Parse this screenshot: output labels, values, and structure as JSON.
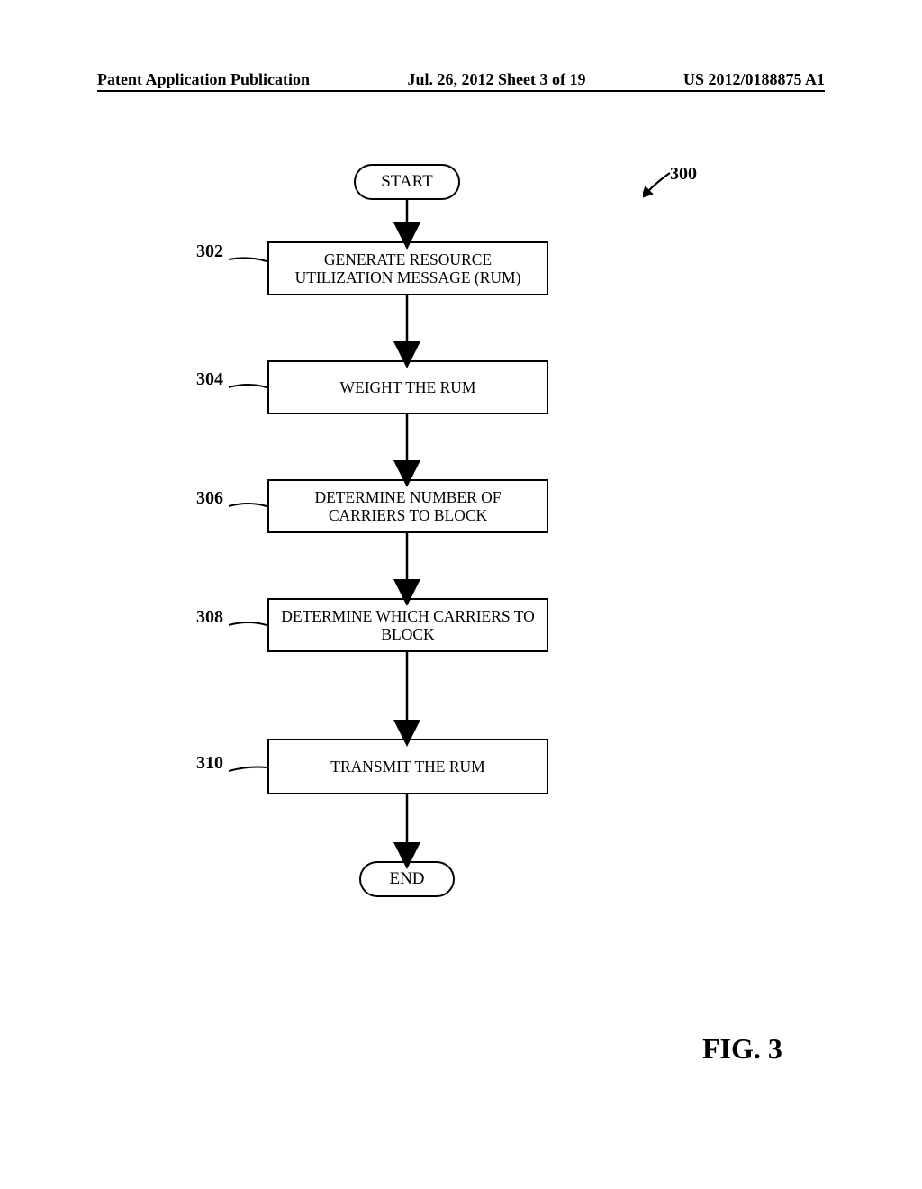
{
  "header": {
    "left": "Patent Application Publication",
    "center": "Jul. 26, 2012  Sheet 3 of 19",
    "right": "US 2012/0188875 A1"
  },
  "figure": {
    "reference": "300",
    "start": "START",
    "end": "END",
    "caption": "FIG. 3",
    "steps": [
      {
        "ref": "302",
        "text": "GENERATE RESOURCE UTILIZATION MESSAGE (RUM)"
      },
      {
        "ref": "304",
        "text": "WEIGHT THE RUM"
      },
      {
        "ref": "306",
        "text": "DETERMINE NUMBER OF CARRIERS TO BLOCK"
      },
      {
        "ref": "308",
        "text": "DETERMINE WHICH CARRIERS TO BLOCK"
      },
      {
        "ref": "310",
        "text": "TRANSMIT THE RUM"
      }
    ]
  }
}
